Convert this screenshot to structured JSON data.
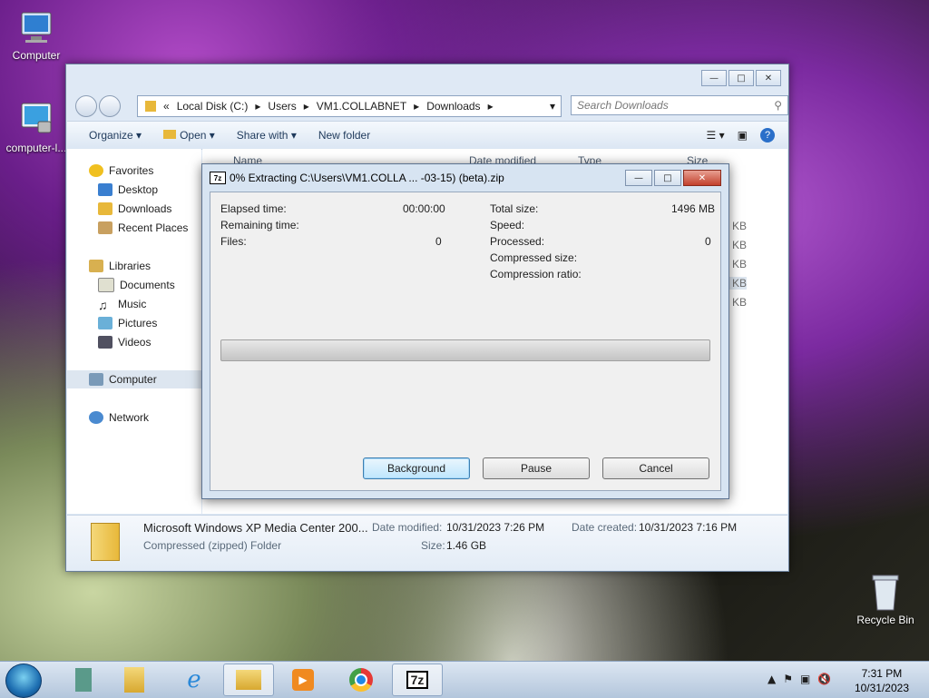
{
  "desktop": {
    "icons": [
      {
        "label": "Computer"
      },
      {
        "label": "computer-l..."
      },
      {
        "label": "Recycle Bin"
      }
    ]
  },
  "explorer": {
    "address": {
      "prefix": "«",
      "crumbs": [
        "Local Disk (C:)",
        "Users",
        "VM1.COLLABNET",
        "Downloads"
      ]
    },
    "search_placeholder": "Search Downloads",
    "toolbar": {
      "organize": "Organize",
      "open": "Open",
      "share_with": "Share with",
      "new_folder": "New folder"
    },
    "nav": {
      "favorites": "Favorites",
      "desktop": "Desktop",
      "downloads": "Downloads",
      "recent_places": "Recent Places",
      "libraries": "Libraries",
      "documents": "Documents",
      "music": "Music",
      "pictures": "Pictures",
      "videos": "Videos",
      "computer": "Computer",
      "network": "Network"
    },
    "columns": {
      "name": "Name",
      "date_modified": "Date modified",
      "type": "Type",
      "size": "Size"
    },
    "sizes": [
      "7 KB",
      "0 KB",
      "1 KB",
      "1 KB",
      "7 KB"
    ],
    "details": {
      "name": "Microsoft Windows XP Media Center 200...",
      "type": "Compressed (zipped) Folder",
      "date_modified_label": "Date modified:",
      "date_modified": "10/31/2023 7:26 PM",
      "date_created_label": "Date created:",
      "date_created": "10/31/2023 7:16 PM",
      "size_label": "Size:",
      "size": "1.46 GB"
    }
  },
  "dialog": {
    "logo": "7z",
    "title": "0% Extracting C:\\Users\\VM1.COLLA ... -03-15) (beta).zip",
    "elapsed_label": "Elapsed time:",
    "elapsed": "00:00:00",
    "remaining_label": "Remaining time:",
    "files_label": "Files:",
    "files": "0",
    "total_size_label": "Total size:",
    "total_size": "1496 MB",
    "speed_label": "Speed:",
    "processed_label": "Processed:",
    "processed": "0",
    "compressed_size_label": "Compressed size:",
    "compression_ratio_label": "Compression ratio:",
    "progress": 0,
    "buttons": {
      "background": "Background",
      "pause": "Pause",
      "cancel": "Cancel"
    }
  },
  "taskbar": {
    "time": "7:31 PM",
    "date": "10/31/2023",
    "sevenzip": "7z"
  }
}
